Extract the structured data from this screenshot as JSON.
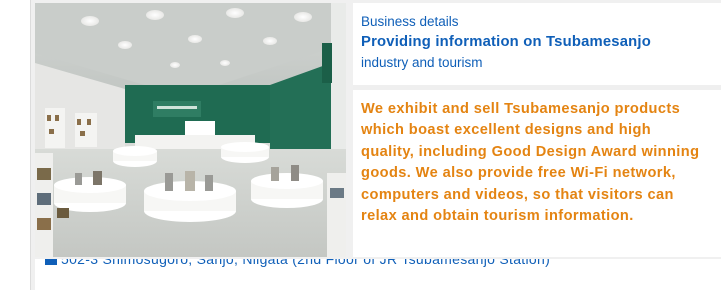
{
  "info": {
    "kicker": "Business details",
    "headline": "Providing information on Tsubamesanjo",
    "sub": "industry and tourism",
    "body_lines": [
      "We exhibit and sell Tsubamesanjo products",
      "which boast excellent designs and high",
      "quality, including Good Design Award winning",
      "goods. We also provide free Wi-Fi network,",
      "computers and videos, so that visitors can",
      "relax and obtain tourism information."
    ]
  },
  "footer": {
    "address": "502-3 Shimosugoro, Sanjo, Niigata (2nd Floor of JR Tsubamesanjo Station)"
  },
  "colors": {
    "heading_blue": "#0f5fb8",
    "body_orange": "#e48412",
    "showroom_green": "#1f6b52"
  }
}
